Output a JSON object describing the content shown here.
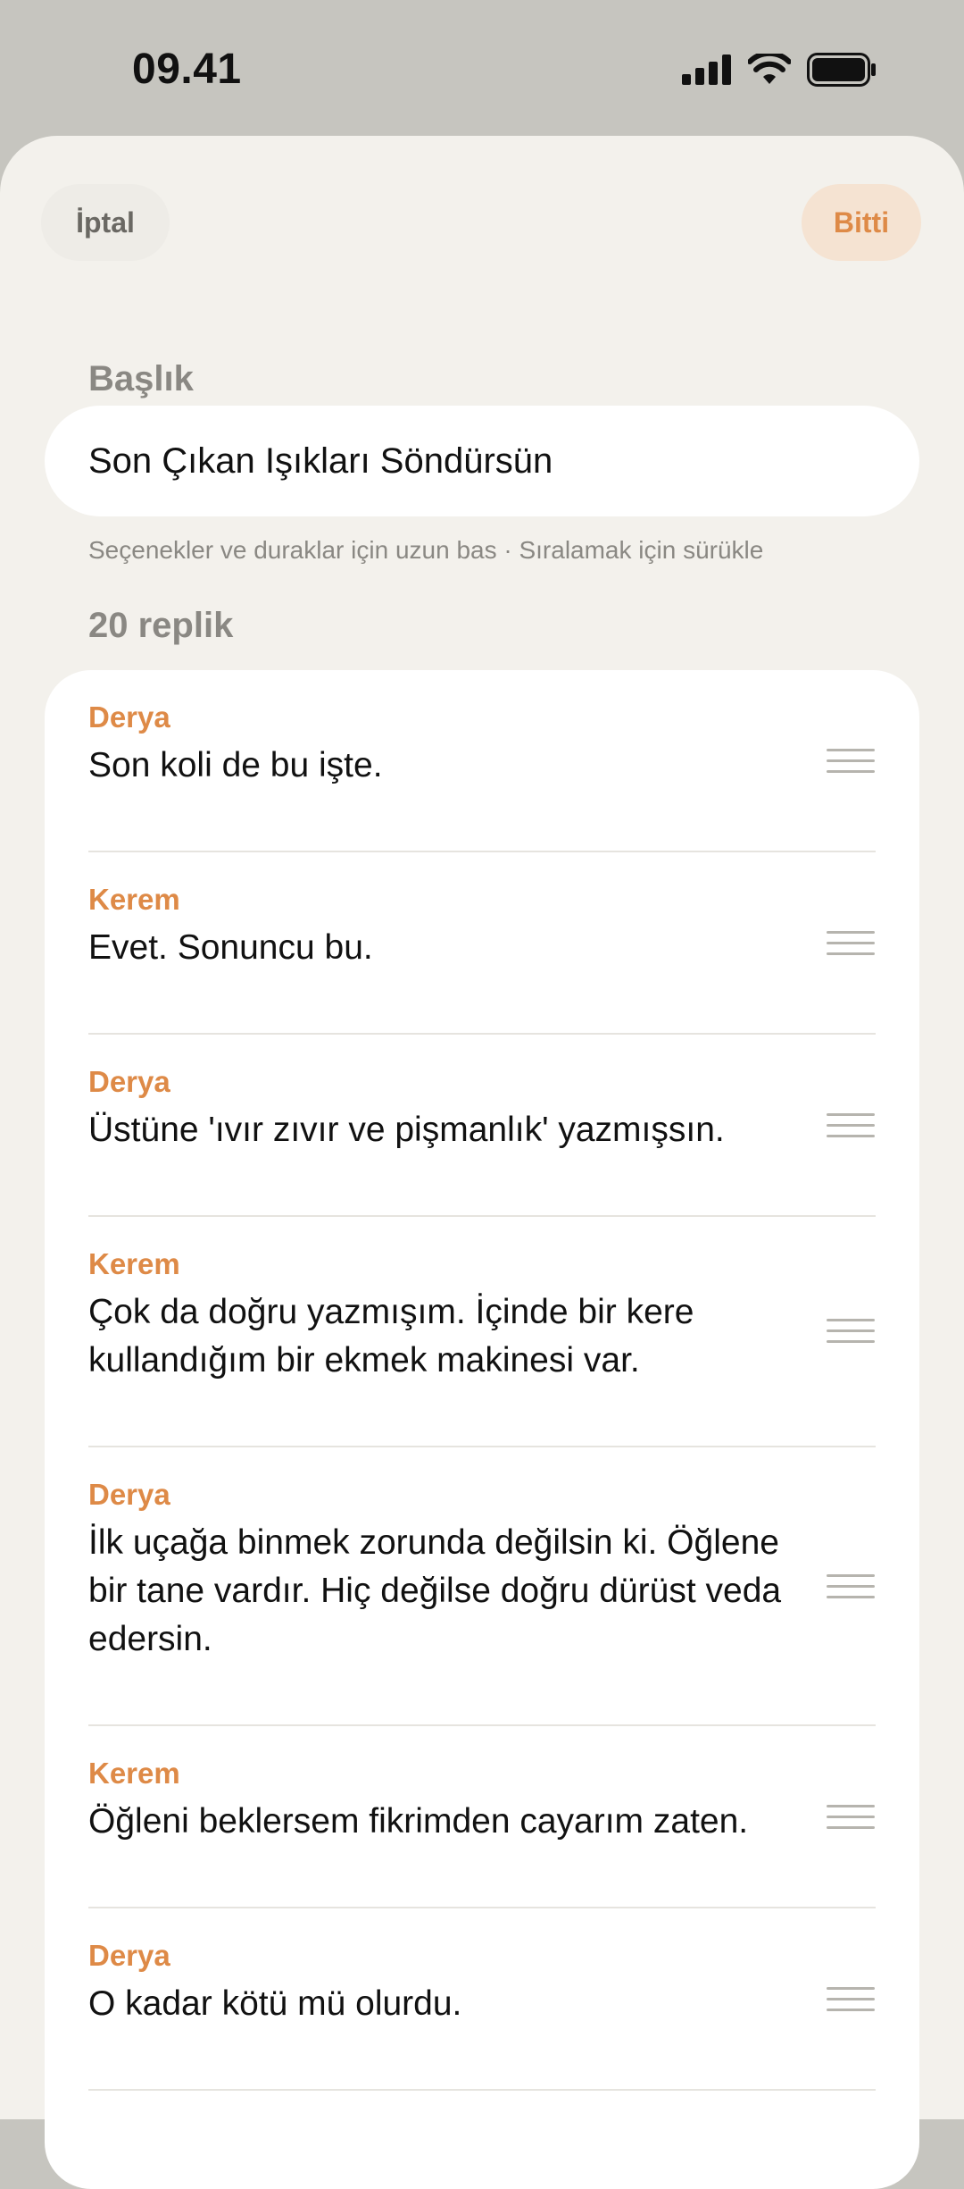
{
  "status": {
    "time": "09.41"
  },
  "nav": {
    "cancel_label": "İptal",
    "done_label": "Bitti"
  },
  "title_section": {
    "label": "Başlık",
    "value": "Son Çıkan Işıkları Söndürsün"
  },
  "hint": "Seçenekler ve duraklar için uzun bas · Sıralamak için sürükle",
  "lines_count_label": "20 replik",
  "lines": [
    {
      "speaker": "Derya",
      "text": "Son koli de bu işte."
    },
    {
      "speaker": "Kerem",
      "text": "Evet. Sonuncu bu."
    },
    {
      "speaker": "Derya",
      "text": "Üstüne 'ıvır zıvır ve pişmanlık' yazmışsın."
    },
    {
      "speaker": "Kerem",
      "text": "Çok da doğru yazmışım. İçinde bir kere kullandığım bir ekmek makinesi var."
    },
    {
      "speaker": "Derya",
      "text": "İlk uçağa binmek zorunda değilsin ki. Öğlene bir tane vardır. Hiç değilse doğru dürüst veda edersin."
    },
    {
      "speaker": "Kerem",
      "text": "Öğleni beklersem fikrimden cayarım zaten."
    },
    {
      "speaker": "Derya",
      "text": "O kadar kötü mü olurdu."
    }
  ],
  "colors": {
    "accent": "#de8a47",
    "sheet_bg": "#f3f1ec",
    "backdrop": "#c6c5bf"
  },
  "icons": [
    "cellular-signal-icon",
    "wifi-icon",
    "battery-icon",
    "drag-handle-icon"
  ]
}
